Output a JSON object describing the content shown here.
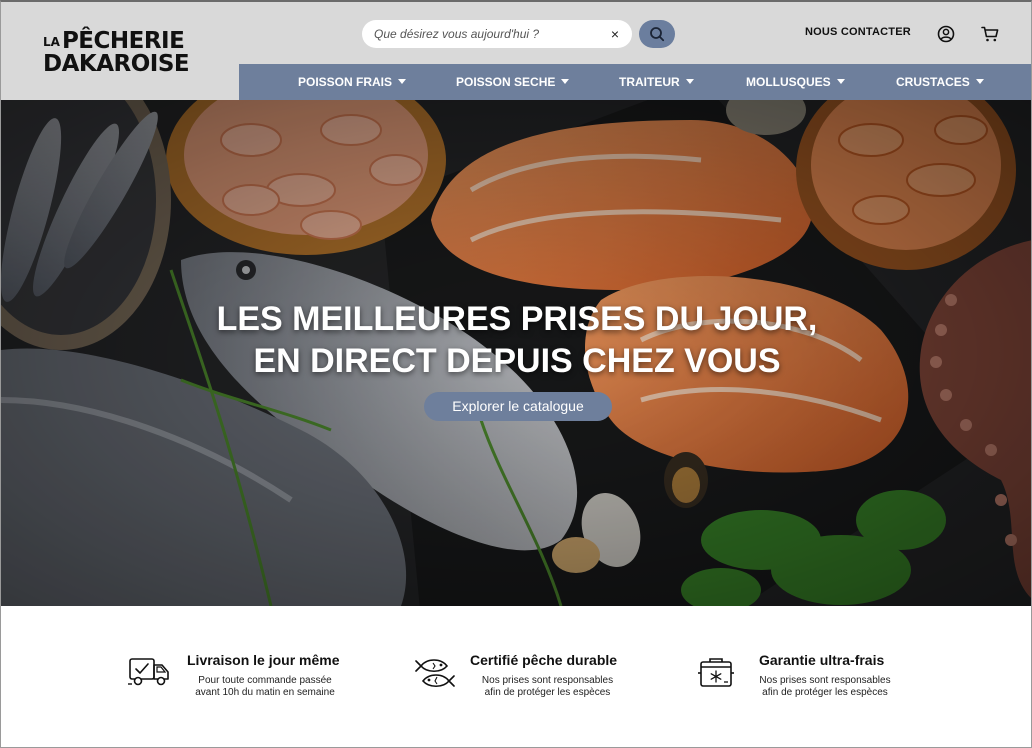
{
  "brand": {
    "prefix": "LA",
    "line1": "PÊCHERIE",
    "line2": "DAKAROISE"
  },
  "search": {
    "placeholder": "Que désirez vous aujourd'hui ?",
    "clear_label": "×"
  },
  "header": {
    "contact_label": "NOUS CONTACTER"
  },
  "nav": {
    "items": [
      {
        "label": "POISSON FRAIS"
      },
      {
        "label": "POISSON SECHE"
      },
      {
        "label": "TRAITEUR"
      },
      {
        "label": "MOLLUSQUES"
      },
      {
        "label": "CRUSTACES"
      }
    ]
  },
  "hero": {
    "title_line1": "LES MEILLEURES PRISES DU JOUR,",
    "title_line2": "EN DIRECT DEPUIS CHEZ VOUS",
    "cta_label": "Explorer le catalogue"
  },
  "features": [
    {
      "icon": "delivery-truck-icon",
      "title": "Livraison le jour même",
      "desc_line1": "Pour toute commande passée",
      "desc_line2": "avant 10h du matin en semaine"
    },
    {
      "icon": "fish-certified-icon",
      "title": "Certifié pêche durable",
      "desc_line1": "Nos prises sont responsables",
      "desc_line2": "afin de protéger les espèces"
    },
    {
      "icon": "cooler-box-icon",
      "title": "Garantie ultra-frais",
      "desc_line1": "Nos prises sont responsables",
      "desc_line2": "afin de protéger les espèces"
    }
  ],
  "colors": {
    "header_bg": "#d9d9d9",
    "nav_bg": "#6e7f9c",
    "accent": "#6e7f9c"
  }
}
